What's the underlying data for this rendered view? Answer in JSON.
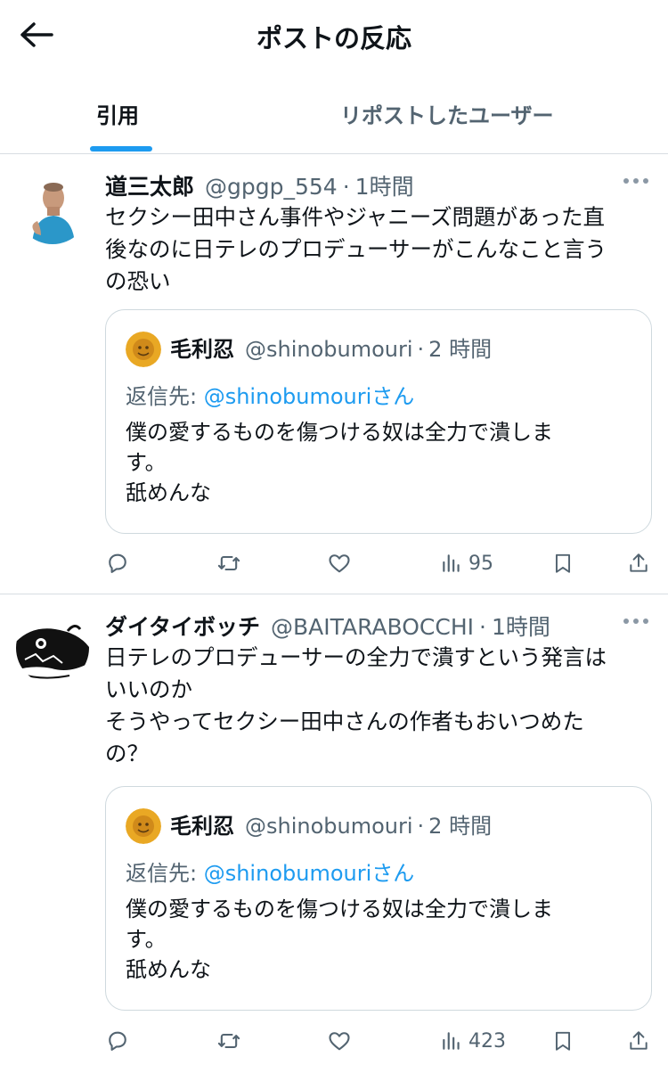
{
  "header": {
    "title": "ポストの反応"
  },
  "tabs": [
    {
      "label": "引用",
      "active": true
    },
    {
      "label": "リポストしたユーザー",
      "active": false
    }
  ],
  "posts": [
    {
      "author": "道三太郎",
      "handle": "@gpgp_554",
      "separator": "·",
      "time": "1時間",
      "text": "セクシー田中さん事件やジャニーズ問題があった直\n後なのに日テレのプロデューサーがこんなこと言う\nの恐い",
      "quote": {
        "author": "毛利忍",
        "handle": "@shinobumouri",
        "separator": "·",
        "time": "2 時間",
        "reply_prefix": "返信先: ",
        "reply_mention": "@shinobumouri",
        "reply_suffix": "さん",
        "text": "僕の愛するものを傷つける奴は全力で潰しま\nす。\n舐めんな"
      },
      "views": "95"
    },
    {
      "author": "ダイタイボッチ",
      "handle": "@BAITARABOCCHI",
      "separator": "·",
      "time": "1時間",
      "text": "日テレのプロデューサーの全力で潰すという発言は\nいいのか\nそうやってセクシー田中さんの作者もおいつめた\nの？",
      "quote": {
        "author": "毛利忍",
        "handle": "@shinobumouri",
        "separator": "·",
        "time": "2 時間",
        "reply_prefix": "返信先: ",
        "reply_mention": "@shinobumouri",
        "reply_suffix": "さん",
        "text": "僕の愛するものを傷つける奴は全力で潰しま\nす。\n舐めんな"
      },
      "views": "423"
    }
  ],
  "icons": {
    "back": "arrow-left-icon",
    "more": "more-dots-icon",
    "reply": "reply-icon",
    "repost": "repost-icon",
    "like": "heart-icon",
    "views": "views-chart-icon",
    "bookmark": "bookmark-icon",
    "share": "share-icon"
  },
  "colors": {
    "accent": "#1d9bf0",
    "text": "#0f1419",
    "secondary": "#536471",
    "border": "#cfd9de"
  }
}
